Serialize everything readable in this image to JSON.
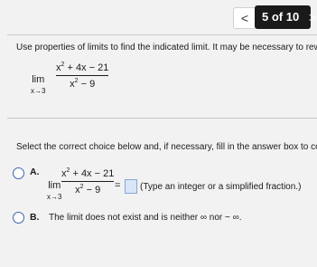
{
  "header": {
    "prev_label": "<",
    "counter": "5 of 10",
    "next_label": ">"
  },
  "question": {
    "instruction": "Use properties of limits to find the indicated limit. It may be necessary to rew",
    "limit_word": "lim",
    "limit_sub": "x→3",
    "numerator_before_exp": "x",
    "numerator_exp": "2",
    "numerator_after_exp": " + 4x − 21",
    "denominator_before_exp": "x",
    "denominator_exp": "2",
    "denominator_after_exp": " − 9"
  },
  "choices": {
    "prompt": "Select the correct choice below and, if necessary, fill in the answer box to co",
    "a": {
      "letter": "A.",
      "equals": "=",
      "answer_value": "",
      "hint": "(Type an integer or a simplified fraction.)"
    },
    "b": {
      "letter": "B.",
      "text": "The limit does not exist and is neither ∞ nor − ∞."
    }
  },
  "colors": {
    "radio_border": "#3d63b0",
    "answer_box_fill": "#d8e6f7",
    "nav_box": "#1a1a1a"
  }
}
